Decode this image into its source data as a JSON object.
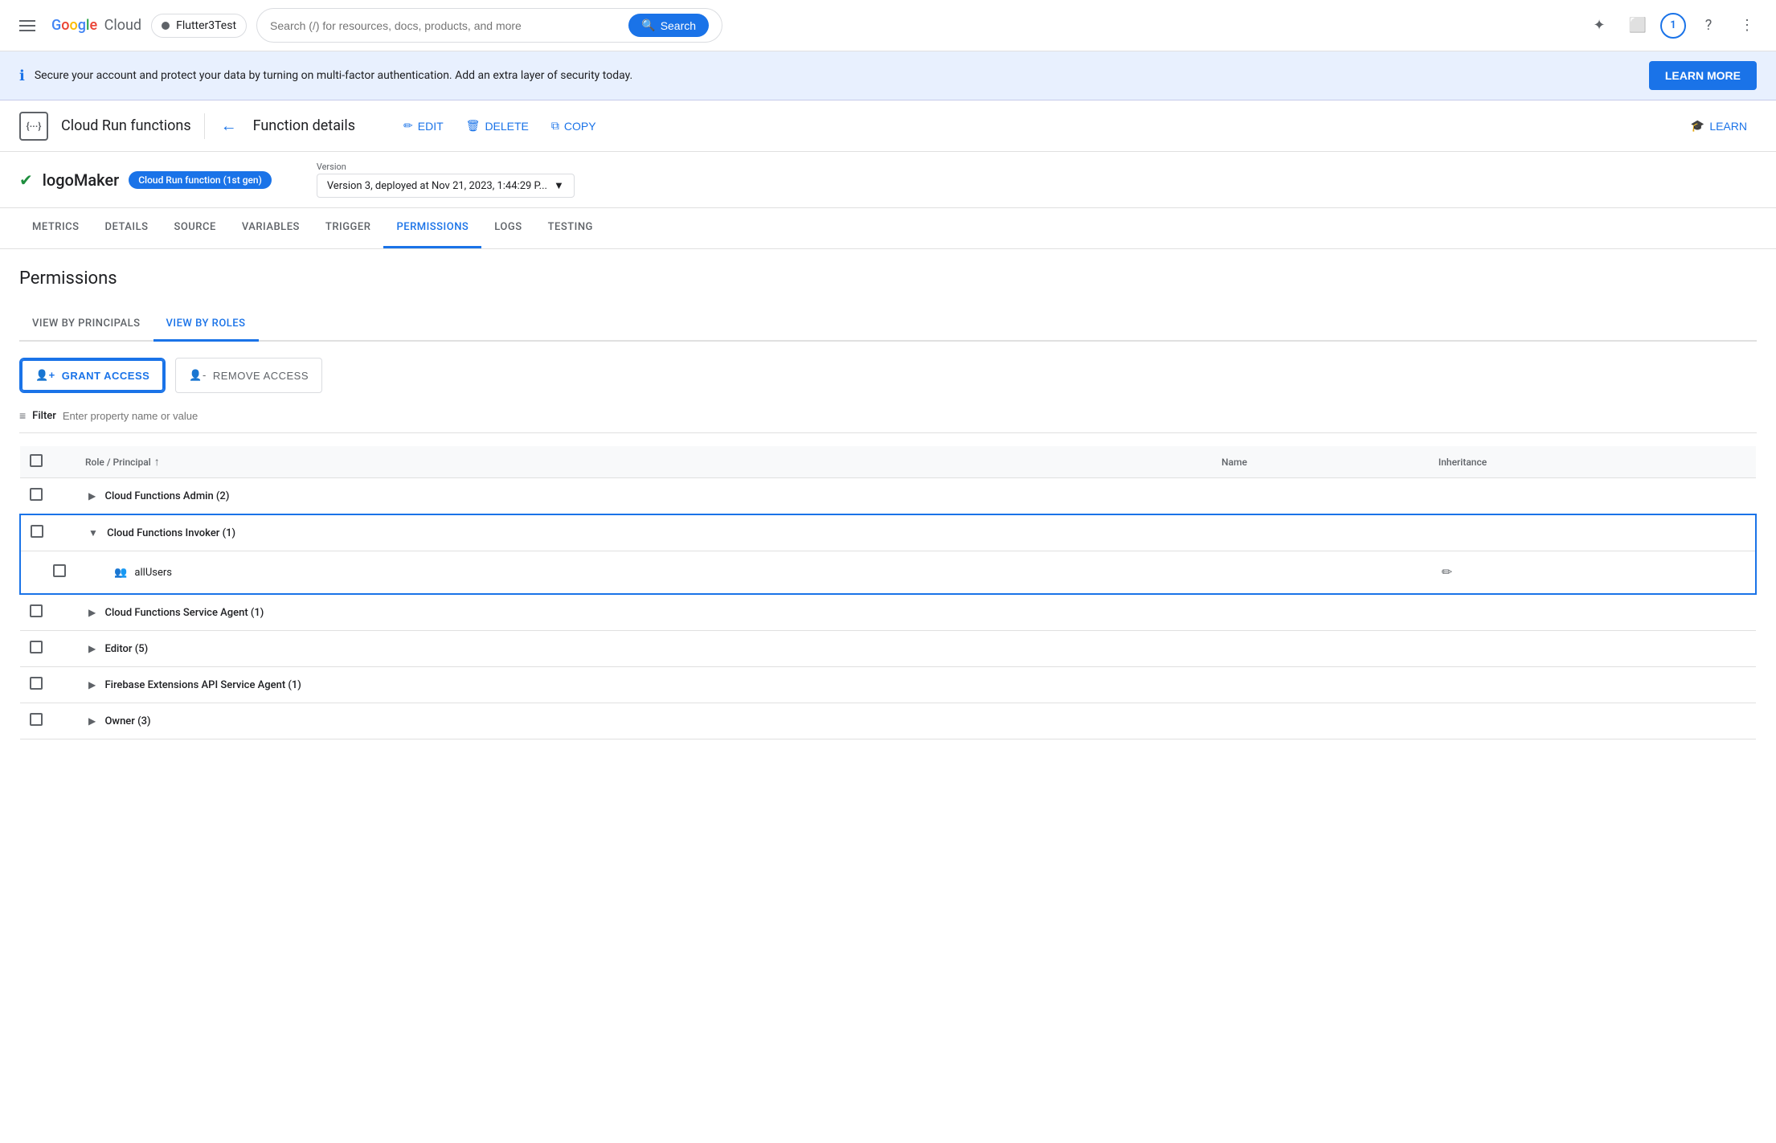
{
  "app": {
    "title": "Google Cloud"
  },
  "topNav": {
    "hamburger": "☰",
    "logoText": "Google Cloud",
    "projectName": "Flutter3Test",
    "searchPlaceholder": "Search (/) for resources, docs, products, and more",
    "searchBtn": "Search",
    "avatarNumber": "1"
  },
  "infoBanner": {
    "text": "Secure your account and protect your data by turning on multi-factor authentication. Add an extra layer of security today.",
    "learnMoreBtn": "LEARN MORE"
  },
  "functionHeader": {
    "serviceLabel": "{···}",
    "serviceName": "Cloud Run functions",
    "backArrow": "←",
    "pageTitle": "Function details",
    "editBtn": "EDIT",
    "deleteBtn": "DELETE",
    "copyBtn": "COPY",
    "learnBtn": "LEARN"
  },
  "functionInfo": {
    "functionName": "logoMaker",
    "badge": "Cloud Run function (1st gen)",
    "versionLabel": "Version",
    "versionValue": "Version 3, deployed at Nov 21, 2023, 1:44:29 P..."
  },
  "tabs": [
    {
      "label": "METRICS",
      "active": false
    },
    {
      "label": "DETAILS",
      "active": false
    },
    {
      "label": "SOURCE",
      "active": false
    },
    {
      "label": "VARIABLES",
      "active": false
    },
    {
      "label": "TRIGGER",
      "active": false
    },
    {
      "label": "PERMISSIONS",
      "active": true
    },
    {
      "label": "LOGS",
      "active": false
    },
    {
      "label": "TESTING",
      "active": false
    }
  ],
  "permissions": {
    "sectionTitle": "Permissions",
    "subTabs": [
      {
        "label": "VIEW BY PRINCIPALS",
        "active": false
      },
      {
        "label": "VIEW BY ROLES",
        "active": true
      }
    ],
    "grantAccessBtn": "GRANT ACCESS",
    "removeAccessBtn": "REMOVE ACCESS",
    "filter": {
      "label": "Filter",
      "placeholder": "Enter property name or value"
    },
    "table": {
      "columns": [
        {
          "label": "Role / Principal",
          "sortable": true
        },
        {
          "label": "Name"
        },
        {
          "label": "Inheritance"
        }
      ],
      "rows": [
        {
          "type": "role",
          "name": "Cloud Functions Admin (2)",
          "expanded": false
        },
        {
          "type": "role",
          "name": "Cloud Functions Invoker (1)",
          "expanded": true,
          "highlighted": true
        },
        {
          "type": "member",
          "name": "allUsers",
          "highlighted": true
        },
        {
          "type": "role",
          "name": "Cloud Functions Service Agent (1)",
          "expanded": false
        },
        {
          "type": "role",
          "name": "Editor (5)",
          "expanded": false
        },
        {
          "type": "role",
          "name": "Firebase Extensions API Service Agent (1)",
          "expanded": false
        },
        {
          "type": "role",
          "name": "Owner (3)",
          "expanded": false
        }
      ]
    }
  }
}
